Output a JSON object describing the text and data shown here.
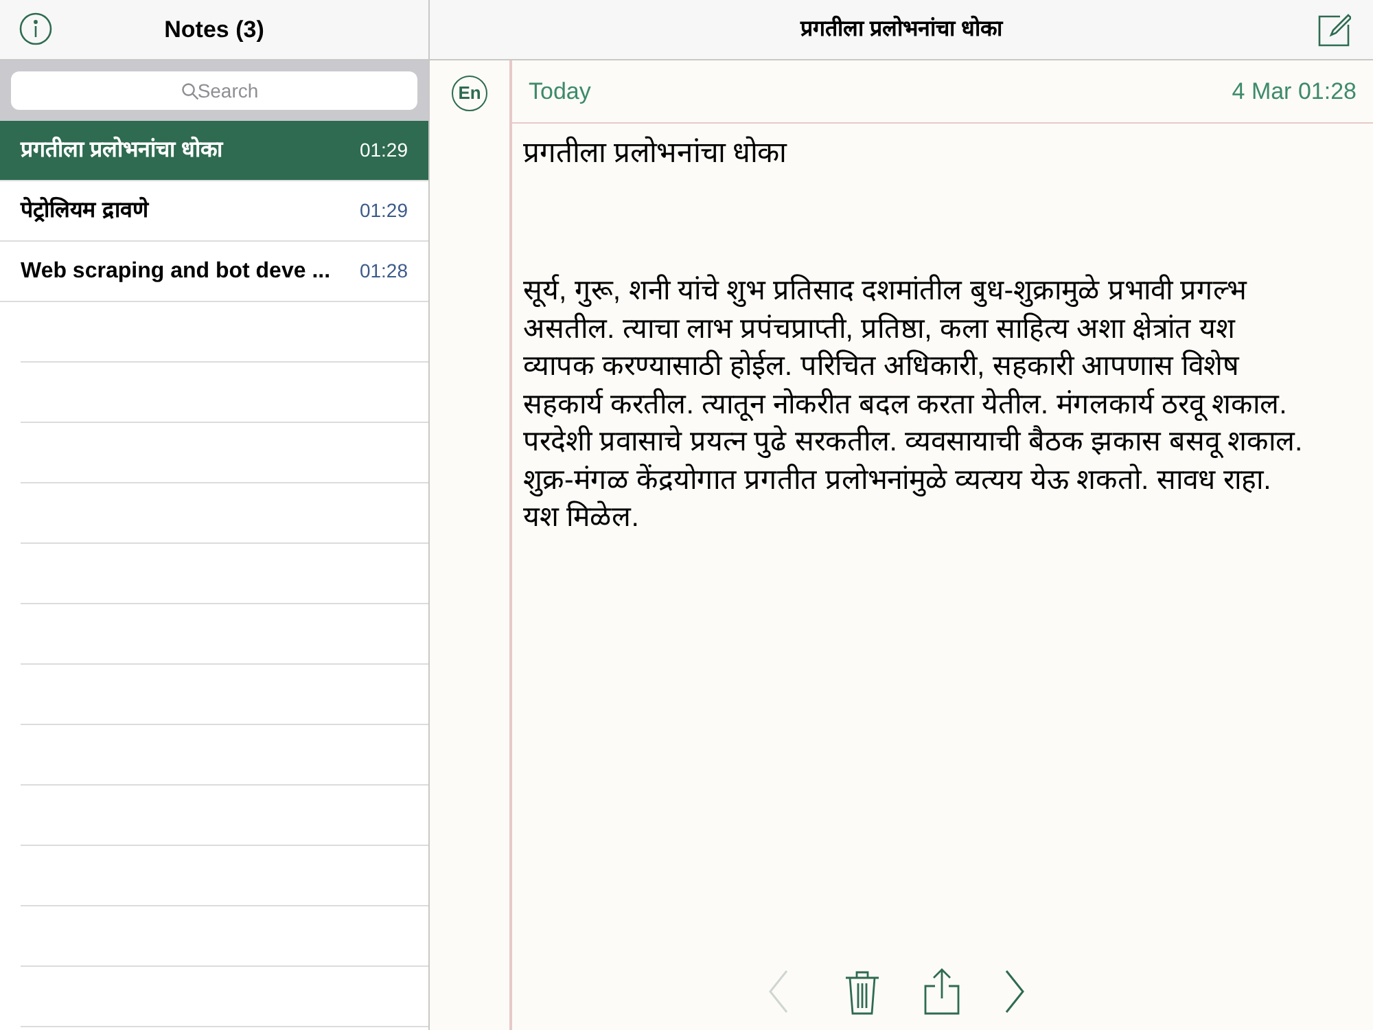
{
  "sidebar": {
    "title": "Notes (3)",
    "search": {
      "placeholder": "Search"
    },
    "notes": [
      {
        "title": "प्रगतीला प्रलोभनांचा धोका",
        "time": "01:29",
        "selected": true
      },
      {
        "title": "पेट्रोलियम द्रावणे",
        "time": "01:29",
        "selected": false
      },
      {
        "title": "Web scraping and bot deve ...",
        "time": "01:28",
        "selected": false
      }
    ]
  },
  "editor": {
    "header_title": "प्रगतीला प्रलोभनांचा धोका",
    "language": "En",
    "day": "Today",
    "date": "4 Mar 01:28",
    "note_title": "प्रगतीला प्रलोभनांचा धोका",
    "body": "सूर्य, गुरू, शनी यांचे शुभ प्रतिसाद दशमांतील बुध-शुक्रामुळे प्रभावी प्रगल्भ असतील. त्याचा लाभ प्रपंचप्राप्ती, प्रतिष्ठा, कला साहित्य अशा क्षेत्रांत यश व्यापक करण्यासाठी होईल. परिचित अधिकारी, सहकारी आपणास विशेष सहकार्य करतील. त्यातून नोकरीत बदल करता येतील. मंगलकार्य ठरवू शकाल. परदेशी प्रवासाचे प्रयत्न पुढे सरकतील. व्यवसायाची बैठक झकास बसवू शकाल. शुक्र-मंगळ केंद्रयोगात प्रगतीत प्रलोभनांमुळे व्यत्यय येऊ शकतो. सावध राहा. यश मिळेल.",
    "toolbar": {
      "previous_disabled": true,
      "next_disabled": false
    }
  }
}
